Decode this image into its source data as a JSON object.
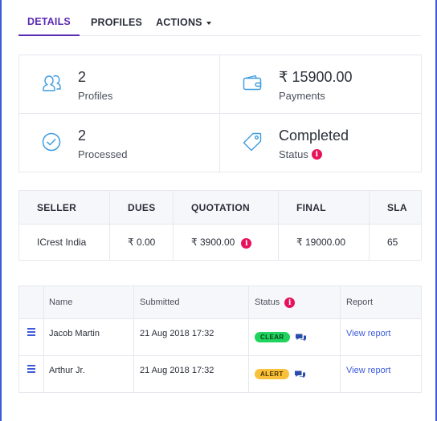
{
  "tabs": [
    {
      "label": "DETAILS",
      "active": true
    },
    {
      "label": "PROFILES",
      "active": false
    },
    {
      "label": "ACTIONS",
      "active": false
    }
  ],
  "stats": {
    "profiles": {
      "value": "2",
      "label": "Profiles",
      "icon": "users-icon"
    },
    "payments": {
      "value": "₹ 15900.00",
      "label": "Payments",
      "icon": "wallet-icon"
    },
    "processed": {
      "value": "2",
      "label": "Processed",
      "icon": "check-circle-icon"
    },
    "status": {
      "value": "Completed",
      "label": "Status",
      "icon": "tag-icon"
    }
  },
  "seller_table": {
    "headers": [
      "SELLER",
      "DUES",
      "QUOTATION",
      "FINAL",
      "SLA"
    ],
    "row": {
      "seller": "ICrest India",
      "dues": "₹ 0.00",
      "quotation": "₹ 3900.00",
      "final": "₹ 19000.00",
      "sla": "65"
    }
  },
  "profiles_table": {
    "headers": [
      "Name",
      "Submitted",
      "Status",
      "Report"
    ],
    "rows": [
      {
        "name": "Jacob Martin",
        "submitted": "21 Aug 2018 17:32",
        "status": "CLEAR",
        "report": "View report"
      },
      {
        "name": "Arthur Jr.",
        "submitted": "21 Aug 2018 17:32",
        "status": "ALERT",
        "report": "View report"
      }
    ]
  },
  "colors": {
    "accent": "#5b2bb5",
    "icon": "#3d9be0",
    "link": "#3d5bd9",
    "info": "#e8115b",
    "clear": "#1fd35c",
    "alert": "#f9c13a"
  }
}
